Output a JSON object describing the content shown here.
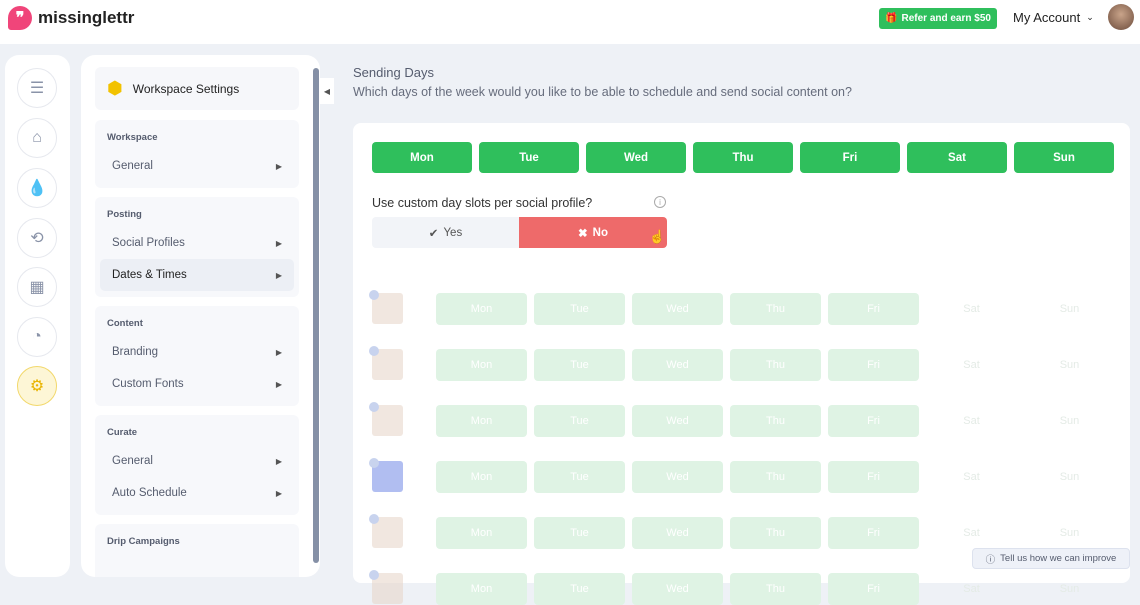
{
  "header": {
    "logo": "missinglettr",
    "refer_label": "Refer and earn $50",
    "account_label": "My Account"
  },
  "icon_sidebar": [
    "menu-icon",
    "home-icon",
    "drop-icon",
    "repeat-icon",
    "calendar-icon",
    "chart-icon",
    "gear-icon"
  ],
  "settings": {
    "title": "Workspace Settings",
    "groups": [
      {
        "heading": "Workspace",
        "items": [
          "General"
        ]
      },
      {
        "heading": "Posting",
        "items": [
          "Social Profiles",
          "Dates & Times"
        ]
      },
      {
        "heading": "Content",
        "items": [
          "Branding",
          "Custom Fonts"
        ]
      },
      {
        "heading": "Curate",
        "items": [
          "General",
          "Auto Schedule"
        ]
      },
      {
        "heading": "Drip Campaigns",
        "items": []
      }
    ],
    "selected": "Dates & Times"
  },
  "main": {
    "title": "Sending Days",
    "subtitle": "Which days of the week would you like to be able to schedule and send social content on?",
    "days": [
      "Mon",
      "Tue",
      "Wed",
      "Thu",
      "Fri",
      "Sat",
      "Sun"
    ],
    "question": "Use custom day slots per social profile?",
    "yes_label": "Yes",
    "no_label": "No",
    "selected_option": "No",
    "profile_rows": 5,
    "profile_enabled_days": [
      "Mon",
      "Tue",
      "Wed",
      "Thu",
      "Fri"
    ]
  },
  "feedback_label": "Tell us how we can improve",
  "colors": {
    "green": "#2fbf5c",
    "red": "#ee6a6a",
    "brand": "#f0457a",
    "gear": "#f2c200"
  }
}
